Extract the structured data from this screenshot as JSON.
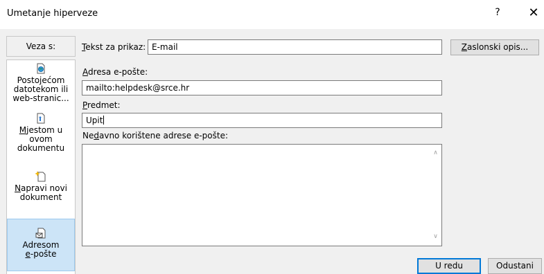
{
  "dialog": {
    "title": "Umetanje hiperveze",
    "help": "?",
    "close": "✕"
  },
  "sidebar": {
    "heading": "Veza s:",
    "items": [
      {
        "label_pre": "Posto",
        "label_ul": "j",
        "label_post": "ećom",
        "line2": "datotekom ili",
        "line3": "web-stranic...",
        "icon": "document-globe-icon",
        "active": false
      },
      {
        "label_pre": "",
        "label_ul": "M",
        "label_post": "jestom u",
        "line2": "ovom",
        "line3": "dokumentu",
        "icon": "document-anchor-icon",
        "active": false
      },
      {
        "label_pre": "",
        "label_ul": "N",
        "label_post": "apravi novi",
        "line2": "dokument",
        "line3": "",
        "icon": "new-document-icon",
        "active": false
      },
      {
        "label_pre": "Adresom",
        "label_ul": "",
        "label_post": "",
        "line2_ul": "e",
        "line2_post": "-pošte",
        "icon": "email-document-icon",
        "active": true
      }
    ]
  },
  "form": {
    "display_text": {
      "label_ul": "T",
      "label_rest": "ekst za prikaz:",
      "value": "E-mail"
    },
    "screentip_button": {
      "ul": "Z",
      "rest": "aslonski opis..."
    },
    "email_address": {
      "label_ul": "A",
      "label_rest": "dresa e-pošte:",
      "value": "mailto:helpdesk@srce.hr"
    },
    "subject": {
      "label_ul": "P",
      "label_rest": "redmet:",
      "value": "Upit"
    },
    "recent": {
      "label_pre": "Ne",
      "label_ul": "d",
      "label_rest": "avno korištene adrese e-pošte:",
      "items": []
    }
  },
  "footer": {
    "ok": "U redu",
    "cancel": "Odustani"
  }
}
